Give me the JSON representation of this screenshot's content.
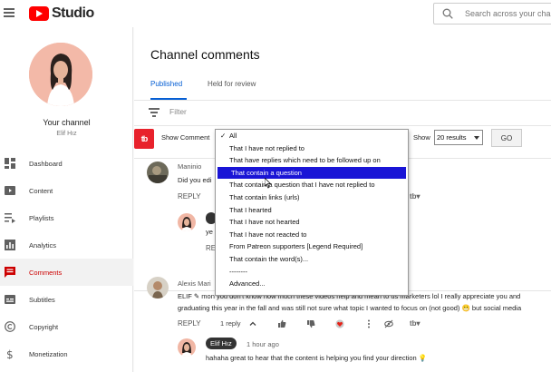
{
  "app": {
    "name": "Studio"
  },
  "search": {
    "placeholder": "Search across your channel"
  },
  "sidebar": {
    "channel_label": "Your channel",
    "channel_name": "Elif Hız",
    "items": [
      {
        "label": "Dashboard",
        "icon": "dashboard-icon"
      },
      {
        "label": "Content",
        "icon": "content-icon"
      },
      {
        "label": "Playlists",
        "icon": "playlists-icon"
      },
      {
        "label": "Analytics",
        "icon": "analytics-icon"
      },
      {
        "label": "Comments",
        "icon": "comments-icon",
        "active": true
      },
      {
        "label": "Subtitles",
        "icon": "subtitles-icon"
      },
      {
        "label": "Copyright",
        "icon": "copyright-icon"
      },
      {
        "label": "Monetization",
        "icon": "monetization-icon"
      }
    ]
  },
  "main": {
    "title": "Channel comments",
    "tabs": [
      {
        "label": "Published",
        "active": true
      },
      {
        "label": "Held for review"
      }
    ],
    "filter_placeholder": "Filter"
  },
  "toolbar": {
    "badge": "tb",
    "show_comments": "Show Comment",
    "show": "Show",
    "results": "20 results",
    "go": "GO"
  },
  "dropdown": {
    "items": [
      "All",
      "That I have not replied to",
      "That have replies which need to be followed up on",
      "That contain a question",
      "That contain a question that I have not replied to",
      "That contain links (urls)",
      "That I hearted",
      "That I have not hearted",
      "That I have not reacted to",
      "From Patreon supporters [Legend Required]",
      "That contain the word(s)...",
      "--------",
      "Advanced..."
    ],
    "checked_index": 0,
    "selected_index": 3
  },
  "comments": [
    {
      "author": "Maninio",
      "text": "Did you edi",
      "reply": "REPLY",
      "reply_text": "ye",
      "reply_action": "RE"
    },
    {
      "author": "Alexis Mari",
      "line1": "ELIF ✎ mon you don't know how much these videos help and mean to us marketers lol I really appreciate you and",
      "line2": "graduating this year in the fall and was still not sure what topic I wanted to focus on (not good) 😬 but social media",
      "reply": "REPLY",
      "replies": "1 reply",
      "owner": "Elif Hız",
      "time": "1 hour ago",
      "owner_text": "hahaha great to hear that the content is helping you find your direction 💡"
    }
  ],
  "colors": {
    "brand_red": "#ff0000",
    "link_blue": "#065fd4",
    "highlight": "#1a15d6",
    "tubebuddy_red": "#e8222c"
  }
}
